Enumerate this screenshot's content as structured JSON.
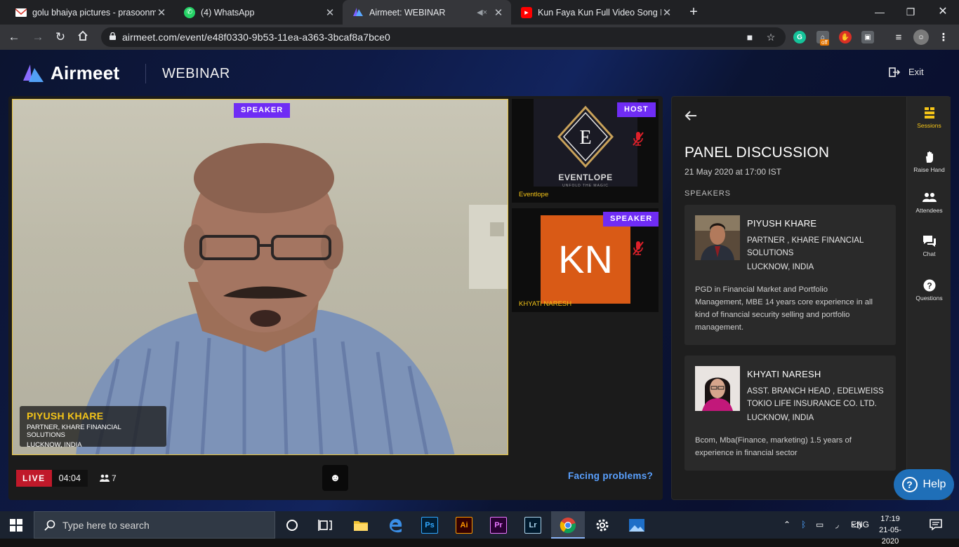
{
  "browser": {
    "tabs": [
      {
        "title": "golu bhaiya pictures - prasoonm",
        "favicon": "gmail-icon"
      },
      {
        "title": "(4) WhatsApp",
        "favicon": "whatsapp-icon"
      },
      {
        "title": "Airmeet: WEBINAR",
        "favicon": "airmeet-icon",
        "muted": true
      },
      {
        "title": "Kun Faya Kun Full Video Song Ro",
        "favicon": "youtube-icon"
      }
    ],
    "url": "airmeet.com/event/e48f0330-9b53-11ea-a363-3bcaf8a7bce0",
    "ext_off_badge": "off"
  },
  "app": {
    "brand": "Airmeet",
    "event_kind": "WEBINAR",
    "exit_label": "Exit",
    "accent": "#6f2cf5",
    "highlight": "#f5c518"
  },
  "stage": {
    "main": {
      "badge": "SPEAKER",
      "name": "PIYUSH KHARE",
      "title": "PARTNER, KHARE FINANCIAL SOLUTIONS",
      "location": "LUCKNOW, INDIA"
    },
    "host_tile": {
      "badge": "HOST",
      "logo_letter": "E",
      "logo_text": "EVENTLOPE",
      "logo_tagline": "UNFOLD THE MAGIC",
      "name": "Eventlope",
      "mic": "muted"
    },
    "speaker_tile": {
      "badge": "SPEAKER",
      "initials": "KN",
      "name": "KHYATI NARESH",
      "mic": "muted"
    },
    "live_label": "LIVE",
    "elapsed": "04:04",
    "viewer_count": "7",
    "emoji_icon": "smiley-icon",
    "facing_problems": "Facing problems?"
  },
  "panel": {
    "title": "PANEL DISCUSSION",
    "date": "21 May 2020 at 17:00 IST",
    "speakers_heading": "SPEAKERS",
    "speakers": [
      {
        "name": "PIYUSH KHARE",
        "role_line1": "PARTNER , KHARE FINANCIAL",
        "role_line2": "SOLUTIONS",
        "location": "LUCKNOW, INDIA",
        "bio_1": "PGD in Financial Market and Portfolio",
        "bio_2": "Management, MBE 14 years core experience in all",
        "bio_3": "kind of financial security selling and portfolio",
        "bio_4": "management."
      },
      {
        "name": "KHYATI NARESH",
        "role_line1": "ASST. BRANCH HEAD , EDELWEISS",
        "role_line2": "TOKIO LIFE INSURANCE CO. LTD.",
        "location": "LUCKNOW, INDIA",
        "bio_1": "Bcom, Mba(Finance, marketing) 1.5 years of",
        "bio_2": "experience in financial sector"
      }
    ],
    "rail": [
      {
        "label": "Sessions",
        "icon": "sessions-icon",
        "active": true
      },
      {
        "label": "Raise Hand",
        "icon": "hand-icon"
      },
      {
        "label": "Attendees",
        "icon": "people-icon"
      },
      {
        "label": "Chat",
        "icon": "chat-icon"
      },
      {
        "label": "Questions",
        "icon": "question-icon"
      }
    ],
    "help_label": "Help"
  },
  "taskbar": {
    "search_placeholder": "Type here to search",
    "apps": [
      "Ps",
      "Ai",
      "Pr",
      "Lr"
    ],
    "lang": "ENG",
    "time": "17:19",
    "date": "21-05-2020"
  }
}
